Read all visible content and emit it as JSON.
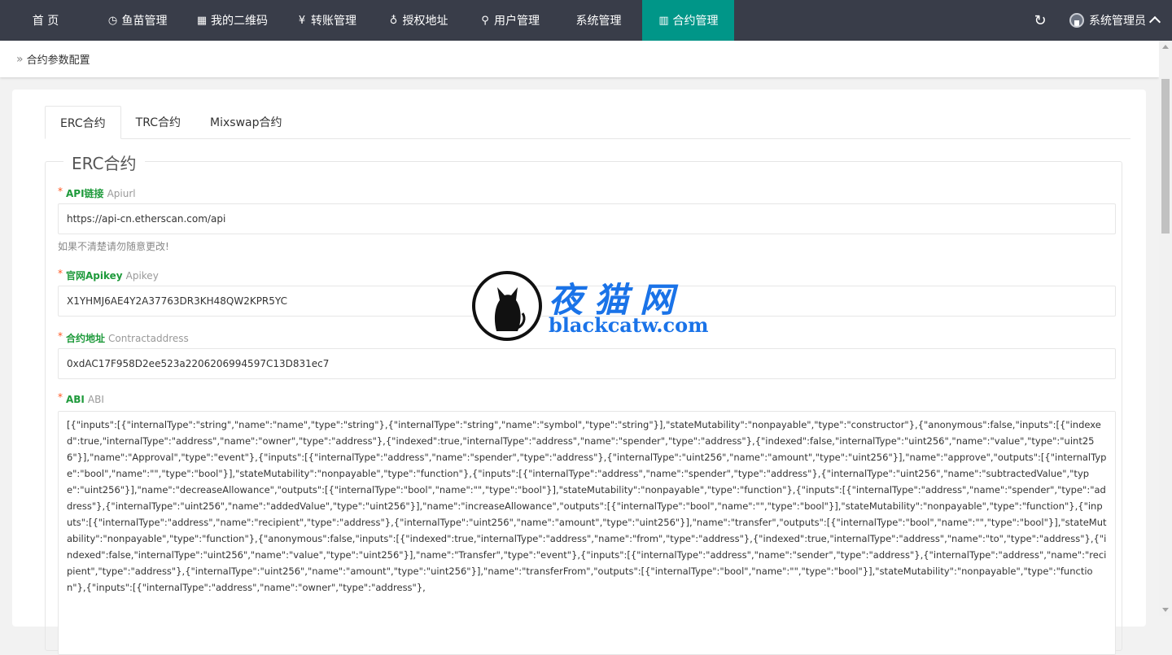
{
  "nav": {
    "items": [
      {
        "label": "首 页",
        "icon": ""
      },
      {
        "label": "鱼苗管理",
        "icon": "clock-icon"
      },
      {
        "label": "我的二维码",
        "icon": "qrcode-icon"
      },
      {
        "label": "转账管理",
        "icon": "yen-icon"
      },
      {
        "label": "授权地址",
        "icon": "location-icon"
      },
      {
        "label": "用户管理",
        "icon": "user-icon"
      },
      {
        "label": "系统管理",
        "icon": ""
      },
      {
        "label": "合约管理",
        "icon": "columns-icon",
        "active": true
      }
    ],
    "user_name": "系统管理员",
    "active_color": "#009688",
    "bar_color": "#393d49"
  },
  "breadcrumb": {
    "text": "合约参数配置"
  },
  "tabs": [
    "ERC合约",
    "TRC合约",
    "Mixswap合约"
  ],
  "form": {
    "legend": "ERC合约",
    "api": {
      "label": "API链接",
      "sub": "Apiurl",
      "value": "https://api-cn.etherscan.com/api",
      "hint": "如果不清楚请勿随意更改!"
    },
    "apikey": {
      "label": "官网Apikey",
      "sub": "Apikey",
      "value": "X1YHMJ6AE4Y2A37763DR3KH48QW2KPR5YC"
    },
    "contract": {
      "label": "合约地址",
      "sub": "Contractaddress",
      "value": "0xdAC17F958D2ee523a2206206994597C13D831ec7"
    },
    "abi": {
      "label": "ABI",
      "sub": "ABI",
      "value": "[{\"inputs\":[{\"internalType\":\"string\",\"name\":\"name\",\"type\":\"string\"},{\"internalType\":\"string\",\"name\":\"symbol\",\"type\":\"string\"}],\"stateMutability\":\"nonpayable\",\"type\":\"constructor\"},{\"anonymous\":false,\"inputs\":[{\"indexed\":true,\"internalType\":\"address\",\"name\":\"owner\",\"type\":\"address\"},{\"indexed\":true,\"internalType\":\"address\",\"name\":\"spender\",\"type\":\"address\"},{\"indexed\":false,\"internalType\":\"uint256\",\"name\":\"value\",\"type\":\"uint256\"}],\"name\":\"Approval\",\"type\":\"event\"},{\"inputs\":[{\"internalType\":\"address\",\"name\":\"spender\",\"type\":\"address\"},{\"internalType\":\"uint256\",\"name\":\"amount\",\"type\":\"uint256\"}],\"name\":\"approve\",\"outputs\":[{\"internalType\":\"bool\",\"name\":\"\",\"type\":\"bool\"}],\"stateMutability\":\"nonpayable\",\"type\":\"function\"},{\"inputs\":[{\"internalType\":\"address\",\"name\":\"spender\",\"type\":\"address\"},{\"internalType\":\"uint256\",\"name\":\"subtractedValue\",\"type\":\"uint256\"}],\"name\":\"decreaseAllowance\",\"outputs\":[{\"internalType\":\"bool\",\"name\":\"\",\"type\":\"bool\"}],\"stateMutability\":\"nonpayable\",\"type\":\"function\"},{\"inputs\":[{\"internalType\":\"address\",\"name\":\"spender\",\"type\":\"address\"},{\"internalType\":\"uint256\",\"name\":\"addedValue\",\"type\":\"uint256\"}],\"name\":\"increaseAllowance\",\"outputs\":[{\"internalType\":\"bool\",\"name\":\"\",\"type\":\"bool\"}],\"stateMutability\":\"nonpayable\",\"type\":\"function\"},{\"inputs\":[{\"internalType\":\"address\",\"name\":\"recipient\",\"type\":\"address\"},{\"internalType\":\"uint256\",\"name\":\"amount\",\"type\":\"uint256\"}],\"name\":\"transfer\",\"outputs\":[{\"internalType\":\"bool\",\"name\":\"\",\"type\":\"bool\"}],\"stateMutability\":\"nonpayable\",\"type\":\"function\"},{\"anonymous\":false,\"inputs\":[{\"indexed\":true,\"internalType\":\"address\",\"name\":\"from\",\"type\":\"address\"},{\"indexed\":true,\"internalType\":\"address\",\"name\":\"to\",\"type\":\"address\"},{\"indexed\":false,\"internalType\":\"uint256\",\"name\":\"value\",\"type\":\"uint256\"}],\"name\":\"Transfer\",\"type\":\"event\"},{\"inputs\":[{\"internalType\":\"address\",\"name\":\"sender\",\"type\":\"address\"},{\"internalType\":\"address\",\"name\":\"recipient\",\"type\":\"address\"},{\"internalType\":\"uint256\",\"name\":\"amount\",\"type\":\"uint256\"}],\"name\":\"transferFrom\",\"outputs\":[{\"internalType\":\"bool\",\"name\":\"\",\"type\":\"bool\"}],\"stateMutability\":\"nonpayable\",\"type\":\"function\"},{\"inputs\":[{\"internalType\":\"address\",\"name\":\"owner\",\"type\":\"address\"},"
    }
  },
  "watermark": {
    "cn": "夜猫网",
    "url": "blackcatw.com"
  }
}
